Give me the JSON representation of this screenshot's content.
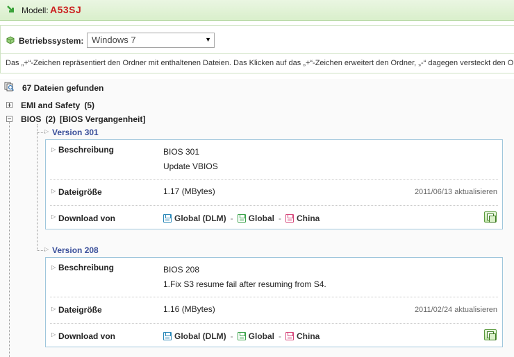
{
  "header": {
    "model_label": "Modell:",
    "model_value": "A53SJ"
  },
  "os": {
    "label": "Betriebssystem:",
    "selected": "Windows 7"
  },
  "hint": "Das „+“-Zeichen repräsentiert den Ordner mit enthaltenen Dateien. Das Klicken auf das „+“-Zeichen erweitert den Ordner, „-“ dagegen versteckt den Ordner.",
  "results": {
    "found": "67 Dateien gefunden"
  },
  "categories": [
    {
      "name": "EMI and Safety",
      "count": "(5)"
    },
    {
      "name": "BIOS",
      "count": "(2)",
      "extra": "[BIOS Vergangenheit]"
    }
  ],
  "versions": [
    {
      "title": "Version 301",
      "desc_label": "Beschreibung",
      "desc_line1": "BIOS 301",
      "desc_line2": "Update VBIOS",
      "size_label": "Dateigröße",
      "size": "1.17 (MBytes)",
      "date": "2011/06/13 aktualisieren",
      "dl_label": "Download von",
      "dl_links": [
        "Global (DLM)",
        "Global",
        "China"
      ]
    },
    {
      "title": "Version 208",
      "desc_label": "Beschreibung",
      "desc_line1": "BIOS 208",
      "desc_line2": "1.Fix S3 resume fail after resuming from S4.",
      "size_label": "Dateigröße",
      "size": "1.16 (MBytes)",
      "date": "2011/02/24 aktualisieren",
      "dl_label": "Download von",
      "dl_links": [
        "Global (DLM)",
        "Global",
        "China"
      ]
    }
  ]
}
